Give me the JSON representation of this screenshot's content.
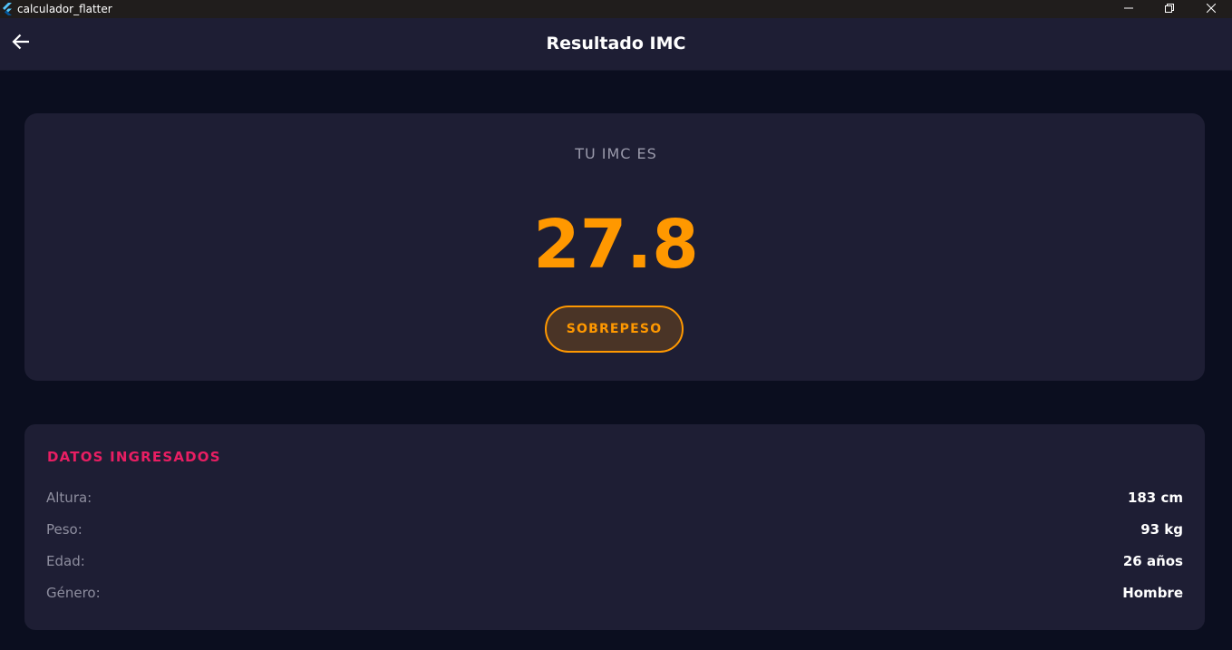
{
  "window": {
    "title": "calculador_flatter",
    "app_icon": "flutter-logo-icon",
    "controls": [
      "minimize-icon",
      "restore-icon",
      "close-icon"
    ]
  },
  "appbar": {
    "title": "Resultado IMC",
    "back_icon": "arrow-left-icon"
  },
  "result": {
    "label": "TU IMC ES",
    "value": "27.8",
    "status": "SOBREPESO",
    "color": "#ff9800"
  },
  "data": {
    "title": "DATOS INGRESADOS",
    "title_color": "#e91e63",
    "rows": [
      {
        "label": "Altura:",
        "value": "183 cm"
      },
      {
        "label": "Peso:",
        "value": "93 kg"
      },
      {
        "label": "Edad:",
        "value": "26 años"
      },
      {
        "label": "Género:",
        "value": "Hombre"
      }
    ]
  }
}
